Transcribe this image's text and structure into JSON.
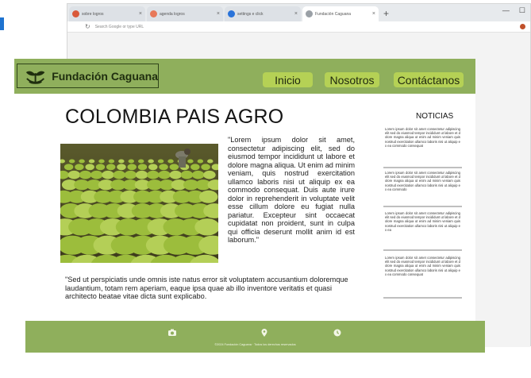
{
  "browser": {
    "tabs": [
      {
        "label": "sobre logros",
        "favicon_color": "#d9593a",
        "active": false
      },
      {
        "label": "agenda logros",
        "favicon_color": "#e8795a",
        "active": false
      },
      {
        "label": "settings e click",
        "favicon_color": "#2a73d9",
        "active": false
      },
      {
        "label": "Fundación Caguana",
        "favicon_color": "#9aa0a6",
        "active": true
      }
    ],
    "new_tab": "+",
    "address": "Search Google or type URL",
    "window_controls": [
      "—",
      "☐"
    ]
  },
  "site": {
    "logo_name": "Fundación Caguana",
    "nav": [
      "Inicio",
      "Nosotros",
      "Contáctanos"
    ],
    "title": "COLOMBIA PAIS AGRO",
    "lorem1": "\"Lorem ipsum dolor sit amet, consectetur adipiscing elit, sed do eiusmod tempor incididunt ut labore et dolore magna aliqua. Ut enim ad minim veniam, quis nostrud exercitation ullamco laboris nisi ut aliquip ex ea commodo consequat. Duis aute irure dolor in reprehenderit in voluptate velit esse cillum dolore eu fugiat nulla pariatur. Excepteur sint occaecat cupidatat non proident, sunt in culpa qui officia deserunt mollit anim id est laborum.\"",
    "lorem2": "\"Sed ut perspiciatis unde omnis iste natus error sit voluptatem accusantium doloremque laudantium, totam rem aperiam, eaque ipsa quae ab illo inventore veritatis et quasi architecto beatae vitae dicta sunt explicabo.",
    "news_title": "NOTICIAS",
    "news": [
      "Lorem ipsum dolor sit amet consectetur adipiscing elit sed do eiusmod tempor incididunt ut labore et dolore magna aliqua ut enim ad minim veniam quis nostrud exercitation ullamco laboris nisi ut aliquip ex ea commodo consequat",
      "Lorem ipsum dolor sit amet consectetur adipiscing elit sed do eiusmod tempor incididunt ut labore et dolore magna aliqua ut enim ad minim veniam quis nostrud exercitation ullamco laboris nisi ut aliquip ex ea commodo",
      "Lorem ipsum dolor sit amet consectetur adipiscing elit sed do eiusmod tempor incididunt ut labore et dolore magna aliqua ut enim ad minim veniam quis nostrud exercitation ullamco laboris nisi ut aliquip ex ea",
      "Lorem ipsum dolor sit amet consectetur adipiscing elit sed do eiusmod tempor incididunt ut labore et dolore magna aliqua ut enim ad minim veniam quis nostrud exercitation ullamco laboris nisi ut aliquip ex ea commodo consequat"
    ],
    "footer_icons": [
      "camera-icon",
      "location-pin-icon",
      "clock-icon"
    ],
    "footer_copy": "©2024 Fundación Caguana · Todos los derechos reservados"
  },
  "colors": {
    "header_green": "#8faf5c",
    "nav_button": "#b5d155",
    "logo_text": "#1f2e0f"
  }
}
